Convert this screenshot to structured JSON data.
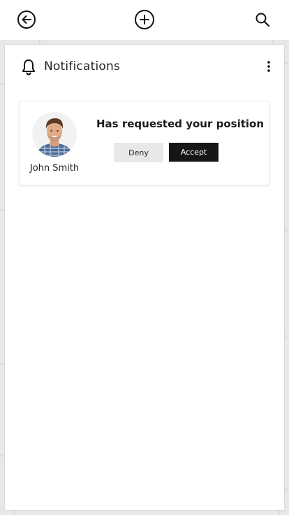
{
  "topbar": {
    "back_icon": "arrow-left-circle-icon",
    "add_icon": "plus-circle-icon",
    "search_icon": "search-icon"
  },
  "panel": {
    "title": "Notifications",
    "title_icon": "bell-icon",
    "menu_icon": "more-vertical-icon"
  },
  "notifications": [
    {
      "user_name": "John Smith",
      "message": "Has requested your position",
      "deny_label": "Deny",
      "accept_label": "Accept"
    }
  ],
  "colors": {
    "accept_bg": "#161616",
    "deny_bg": "#e8e8e8",
    "text": "#222222"
  }
}
